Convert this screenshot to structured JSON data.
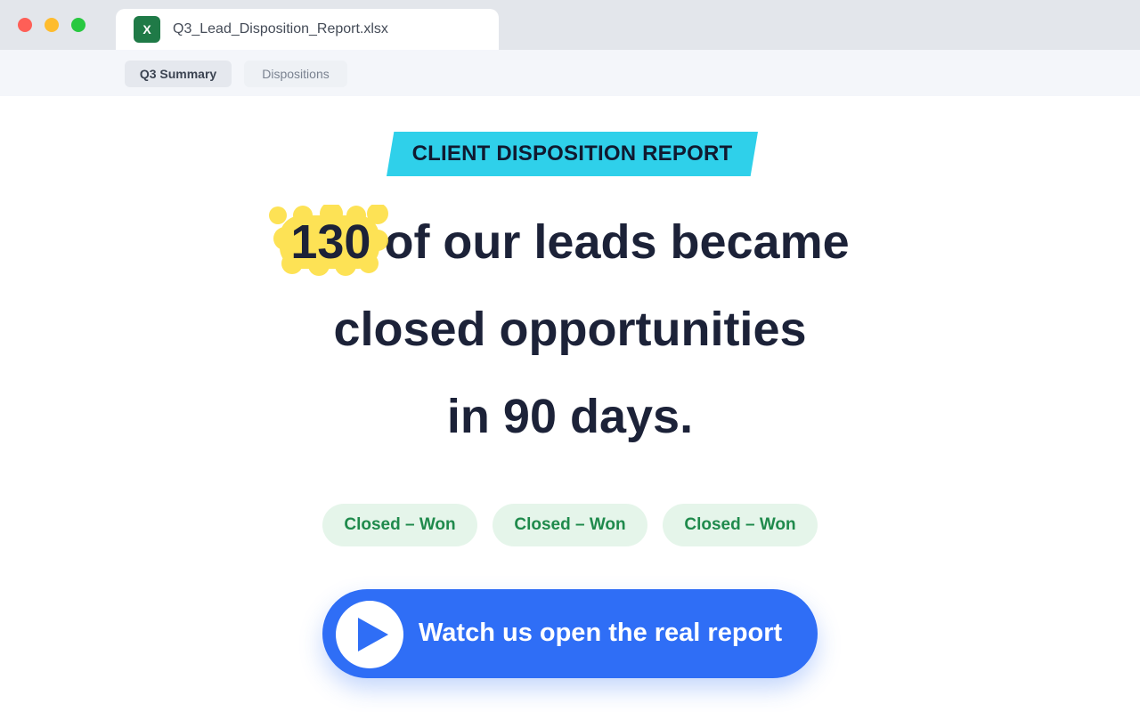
{
  "window": {
    "file_name": "Q3_Lead_Disposition_Report.xlsx",
    "app_icon_letter": "X",
    "app_icon_color": "#1f7a47"
  },
  "sheet_tabs": [
    {
      "label": "Q3 Summary",
      "active": true
    },
    {
      "label": "Dispositions",
      "active": false
    }
  ],
  "banner": {
    "label": "CLIENT DISPOSITION REPORT",
    "color": "#2fd0ea"
  },
  "headline": {
    "highlight_number": "130",
    "line1_rest": " of our leads became",
    "line2": "closed opportunities",
    "line3": "in 90 days.",
    "highlight_color": "#fde047"
  },
  "status_pills": [
    {
      "label": "Closed – Won"
    },
    {
      "label": "Closed – Won"
    },
    {
      "label": "Closed – Won"
    }
  ],
  "cta": {
    "label": "Watch us open the real report",
    "icon": "play-icon",
    "color": "#2f6ef6"
  }
}
